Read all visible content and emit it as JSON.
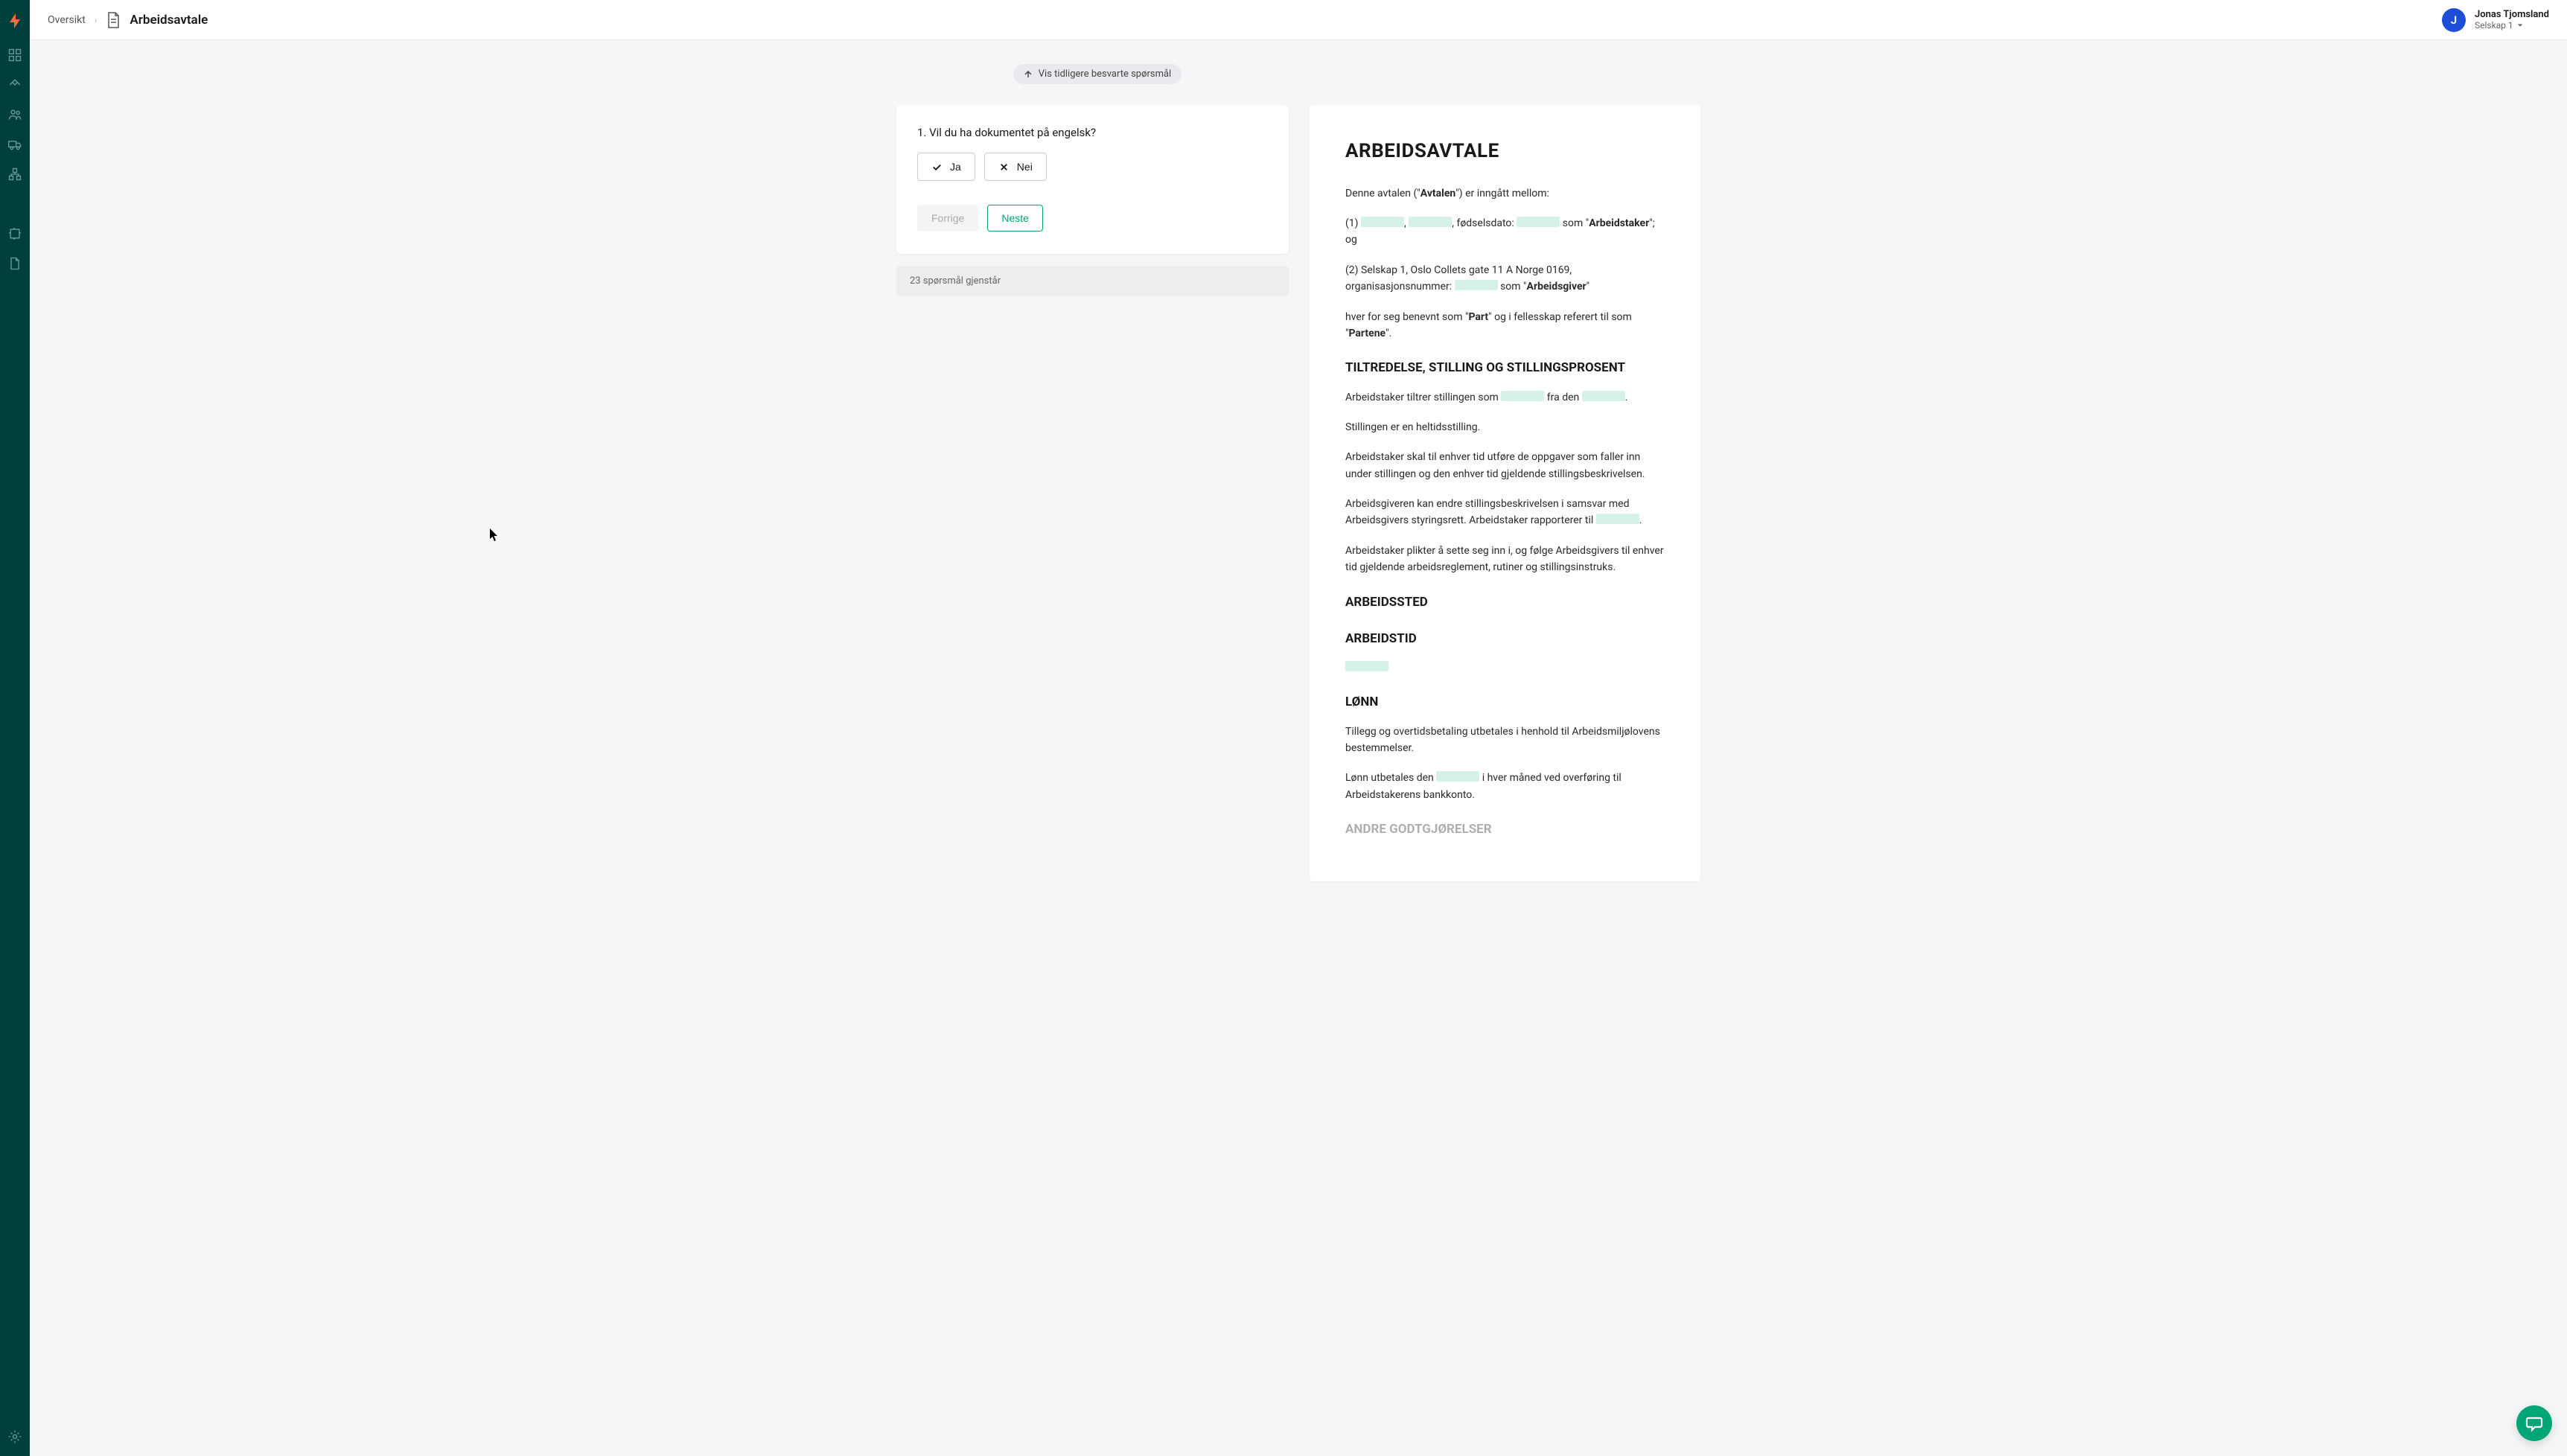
{
  "header": {
    "breadcrumb_root": "Oversikt",
    "page_title": "Arbeidsavtale",
    "user_name": "Jonas Tjomsland",
    "user_initial": "J",
    "company": "Selskap 1"
  },
  "questions_panel": {
    "previous_label": "Vis tidligere besvarte spørsmål",
    "question_text": "1. Vil du ha dokumentet på engelsk?",
    "answer_yes": "Ja",
    "answer_no": "Nei",
    "prev_button": "Forrige",
    "next_button": "Neste",
    "remaining": "23 spørsmål gjenstår"
  },
  "document": {
    "title": "ARBEIDSAVTALE",
    "intro_prefix": "Denne avtalen (\"",
    "intro_bold1": "Avtalen",
    "intro_suffix": "\") er inngått mellom:",
    "p1_prefix": "(1) ",
    "p1_mid1": ", ",
    "p1_mid2": ", fødselsdato: ",
    "p1_mid3": " som \"",
    "p1_bold": "Arbeidstaker",
    "p1_end": "\"; og",
    "p2_prefix": "(2) Selskap 1, Oslo Collets gate 11 A Norge 0169, organisasjonsnummer: ",
    "p2_mid": " som \"",
    "p2_bold": "Arbeidsgiver",
    "p2_end": "\"",
    "p3_prefix": "hver for seg benevnt som \"",
    "p3_bold1": "Part",
    "p3_mid": "\" og i fellesskap referert til som \"",
    "p3_bold2": "Partene",
    "p3_end": "\".",
    "sec1_title": "TILTREDELSE, STILLING OG STILLINGSPROSENT",
    "sec1_p1_a": "Arbeidstaker tiltrer stillingen som ",
    "sec1_p1_b": " fra den ",
    "sec1_p1_c": ".",
    "sec1_p2": "Stillingen er en heltidsstilling.",
    "sec1_p3": "Arbeidstaker skal til enhver tid utføre de oppgaver som faller inn under stillingen og den enhver tid gjeldende stillingsbeskrivelsen.",
    "sec1_p4_a": "Arbeidsgiveren kan endre stillingsbeskrivelsen i samsvar med Arbeidsgivers styringsrett. Arbeidstaker rapporterer til ",
    "sec1_p4_b": ".",
    "sec1_p5": "Arbeidstaker plikter å sette seg inn i, og følge Arbeidsgivers til enhver tid gjeldende arbeidsreglement, rutiner og stillingsinstruks.",
    "sec2_title": "ARBEIDSSTED",
    "sec3_title": "ARBEIDSTID",
    "sec4_title": "LØNN",
    "sec4_p1": "Tillegg og overtidsbetaling utbetales i henhold til Arbeidsmiljølovens bestemmelser.",
    "sec4_p2_a": "Lønn utbetales den ",
    "sec4_p2_b": " i hver måned ved overføring til Arbeidstakerens bankkonto.",
    "sec5_title": "ANDRE GODTGJØRELSER"
  }
}
